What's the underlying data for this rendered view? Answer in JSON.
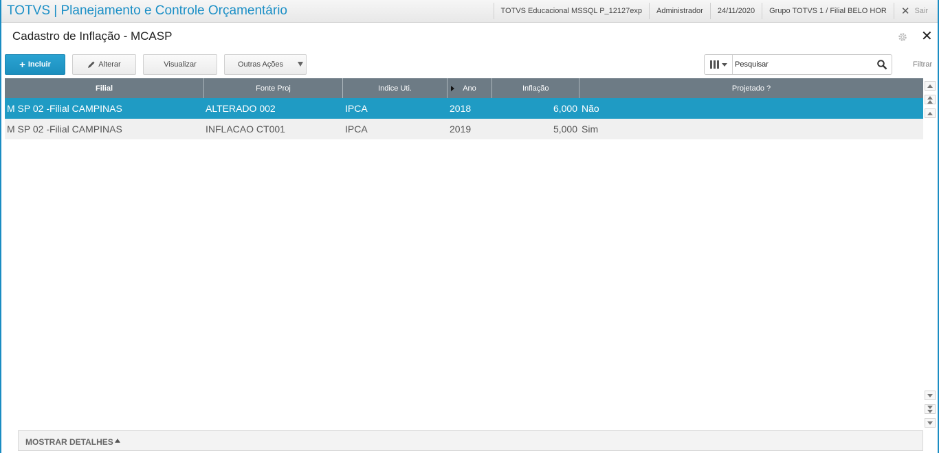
{
  "app": {
    "title": "TOTVS | Planejamento e Controle Orçamentário",
    "environment": "TOTVS Educacional MSSQL P_12127exp",
    "user": "Administrador",
    "date": "24/11/2020",
    "company": "Grupo TOTVS 1 / Filial BELO HOR",
    "exit_label": "Sair"
  },
  "page": {
    "title": "Cadastro de Inflação - MCASP"
  },
  "toolbar": {
    "incluir_label": "Incluir",
    "alterar_label": "Alterar",
    "visualizar_label": "Visualizar",
    "outras_acoes_label": "Outras Ações"
  },
  "search": {
    "placeholder": "Pesquisar",
    "filter_label": "Filtrar"
  },
  "grid": {
    "columns": [
      "Filial",
      "Fonte Proj",
      "Indice Uti.",
      "Ano",
      "Inflação",
      "Projetado ?"
    ],
    "rows": [
      {
        "filial": "M SP 02 -Filial CAMPINAS",
        "fonte": "ALTERADO 002",
        "indice": "IPCA",
        "ano": "2018",
        "inflacao": "6,000",
        "projetado": "Não",
        "selected": true
      },
      {
        "filial": "M SP 02 -Filial CAMPINAS",
        "fonte": "INFLACAO CT001",
        "indice": "IPCA",
        "ano": "2019",
        "inflacao": "5,000",
        "projetado": "Sim",
        "selected": false
      }
    ]
  },
  "details": {
    "label": "MOSTRAR DETALHES"
  },
  "colors": {
    "brand": "#1b8fc6",
    "selected_row": "#1f9bc4",
    "header": "#6d7b85"
  }
}
